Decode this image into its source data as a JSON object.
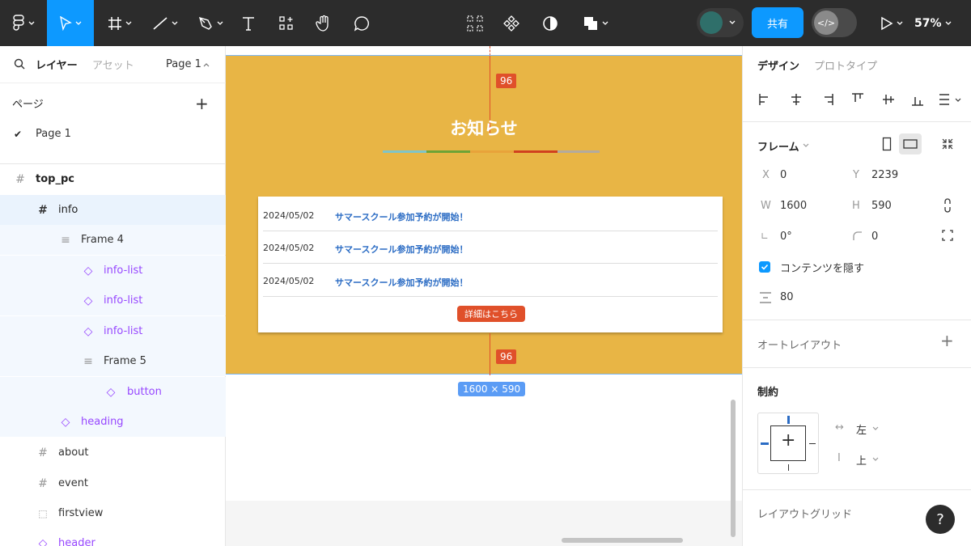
{
  "toolbar": {
    "zoom": "57%",
    "share_label": "共有",
    "dev_mode_label": "</>",
    "avatar_color": "#2f6f6a",
    "accent": "#0d99ff"
  },
  "left": {
    "tabs": {
      "layers": "レイヤー",
      "assets": "アセット",
      "page_selector": "Page 1"
    },
    "pages_title": "ページ",
    "pages": [
      "Page 1"
    ],
    "layers": [
      {
        "name": "top_pc",
        "icon": "frame-icon"
      },
      {
        "name": "info",
        "icon": "frame-icon"
      },
      {
        "name": "Frame 4",
        "icon": "auto-layout-icon"
      },
      {
        "name": "info-list",
        "icon": "instance-icon"
      },
      {
        "name": "info-list",
        "icon": "instance-icon"
      },
      {
        "name": "info-list",
        "icon": "instance-icon"
      },
      {
        "name": "Frame 5",
        "icon": "auto-layout-icon"
      },
      {
        "name": "button",
        "icon": "instance-icon"
      },
      {
        "name": "heading",
        "icon": "instance-icon"
      },
      {
        "name": "about",
        "icon": "frame-icon"
      },
      {
        "name": "event",
        "icon": "frame-icon"
      },
      {
        "name": "firstview",
        "icon": "section-icon"
      },
      {
        "name": "header",
        "icon": "instance-icon"
      }
    ]
  },
  "canvas": {
    "frame_color": "#e8b545",
    "spacing_top": "96",
    "spacing_bottom": "96",
    "heading": "お知らせ",
    "underline_colors": [
      "#7fc4c8",
      "#6ea336",
      "#e8a33a",
      "#d0401f",
      "#b3aa9e"
    ],
    "news": [
      {
        "date": "2024/05/02",
        "title": "サマースクール参加予約が開始！"
      },
      {
        "date": "2024/05/02",
        "title": "サマースクール参加予約が開始！"
      },
      {
        "date": "2024/05/02",
        "title": "サマースクール参加予約が開始！"
      }
    ],
    "more_button": "詳細はこちら",
    "frame_size": "1600 × 590"
  },
  "right": {
    "tabs": {
      "design": "デザイン",
      "prototype": "プロトタイプ"
    },
    "frame_label": "フレーム",
    "x_label": "X",
    "x": "0",
    "y_label": "Y",
    "y": "2239",
    "w_label": "W",
    "w": "1600",
    "h_label": "H",
    "h": "590",
    "rotation": "0°",
    "radius": "0",
    "clip_content": "コンテンツを隠す",
    "spacing": "80",
    "auto_layout": "オートレイアウト",
    "constraints": "制約",
    "constraint_h": "左",
    "constraint_v": "上",
    "layout_grid": "レイアウトグリッド",
    "help": "?"
  }
}
